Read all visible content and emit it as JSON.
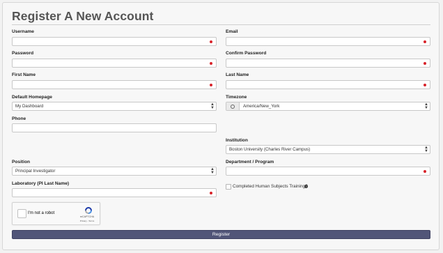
{
  "title": "Register A New Account",
  "username": {
    "label": "Username",
    "value": ""
  },
  "email": {
    "label": "Email",
    "value": ""
  },
  "password": {
    "label": "Password",
    "value": ""
  },
  "confirm_password": {
    "label": "Confirm Password",
    "value": ""
  },
  "first_name": {
    "label": "First Name",
    "value": ""
  },
  "last_name": {
    "label": "Last Name",
    "value": ""
  },
  "default_homepage": {
    "label": "Default Homepage",
    "value": "My Dashboard"
  },
  "timezone": {
    "label": "Timezone",
    "value": "America/New_York"
  },
  "phone": {
    "label": "Phone",
    "value": ""
  },
  "institution": {
    "label": "Institution",
    "value": "Boston University (Charles River Campus)"
  },
  "position": {
    "label": "Position",
    "value": "Principal Investigator"
  },
  "department": {
    "label": "Department / Program",
    "value": ""
  },
  "laboratory": {
    "label": "Laboratory (PI Last Name)",
    "value": ""
  },
  "human_subjects": {
    "label": "Completed Human Subjects Training?",
    "checked": false
  },
  "recaptcha": {
    "label": "I'm not a robot",
    "brand": "reCAPTCHA",
    "links": "Privacy - Terms"
  },
  "register_label": "Register",
  "colors": {
    "required": "#d8232a",
    "button": "#515578"
  },
  "icons": {
    "required": "required-dot-icon",
    "select": "select-caret-icon",
    "timezone": "clock-icon",
    "help": "help-icon",
    "recaptcha": "recaptcha-logo-icon"
  }
}
